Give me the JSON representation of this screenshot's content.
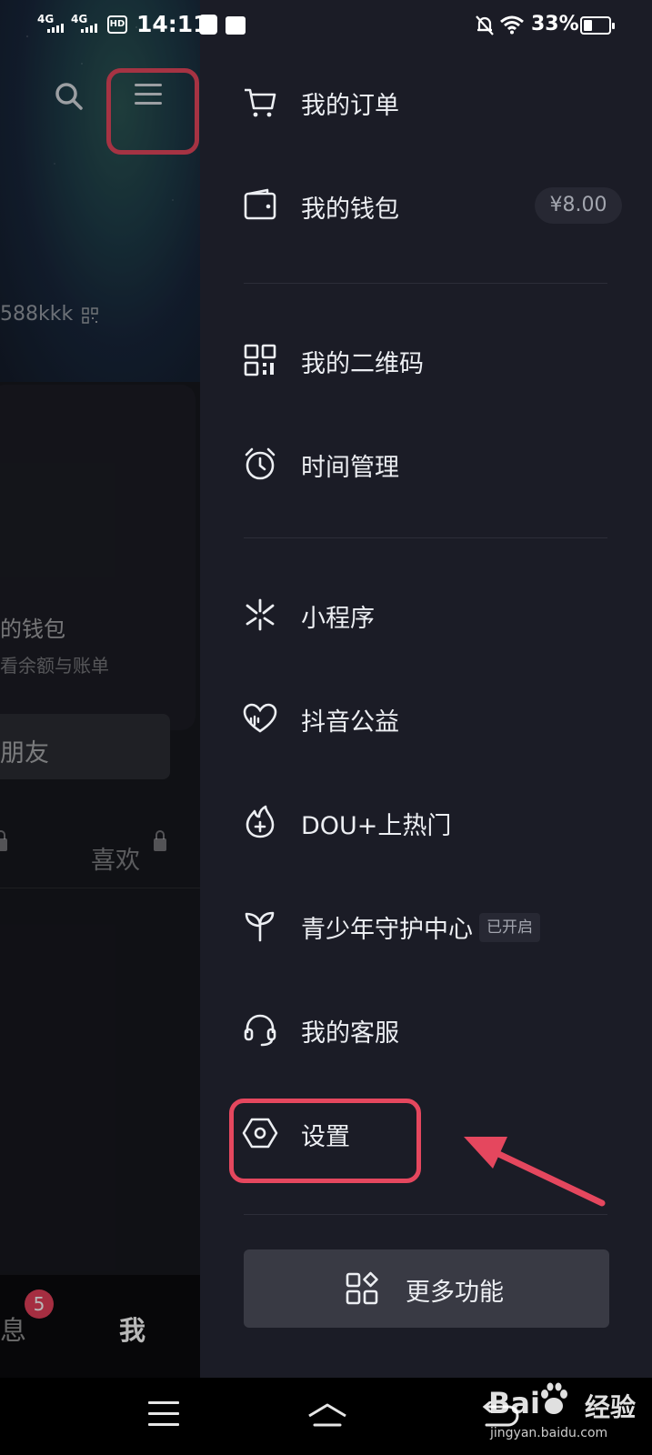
{
  "status_bar": {
    "signal_1": "4G",
    "signal_2": "4G",
    "hd": "HD",
    "time": "14:11",
    "battery_pct": "33%",
    "battery_level": 0.33
  },
  "background_page": {
    "user_id": "588kkk",
    "wallet_title": "我的钱包",
    "wallet_subtitle": "查看余额与账单",
    "add_friend": "加朋友",
    "like_tab": "喜欢",
    "bottom_tabs": {
      "messages": "消息",
      "messages_badge": "5",
      "me": "我"
    }
  },
  "drawer": {
    "group1": [
      {
        "label": "我的订单",
        "icon": "cart-icon"
      },
      {
        "label": "我的钱包",
        "icon": "wallet-icon",
        "badge": "¥8.00"
      }
    ],
    "group2": [
      {
        "label": "我的二维码",
        "icon": "qr-code-icon"
      },
      {
        "label": "时间管理",
        "icon": "alarm-clock-icon"
      }
    ],
    "group3": [
      {
        "label": "小程序",
        "icon": "mini-program-icon"
      },
      {
        "label": "抖音公益",
        "icon": "charity-heart-icon"
      },
      {
        "label": "DOU+上热门",
        "icon": "flame-plus-icon"
      },
      {
        "label": "青少年守护中心",
        "icon": "sprout-icon",
        "tag": "已开启"
      },
      {
        "label": "我的客服",
        "icon": "headset-icon"
      },
      {
        "label": "设置",
        "icon": "settings-hexagon-icon"
      }
    ],
    "more_button": {
      "label": "更多功能",
      "icon": "apps-grid-icon"
    }
  },
  "annotation_color": "#e5475e",
  "watermark": {
    "logo": "Bai",
    "brand": "经验",
    "url": "jingyan.baidu.com"
  }
}
